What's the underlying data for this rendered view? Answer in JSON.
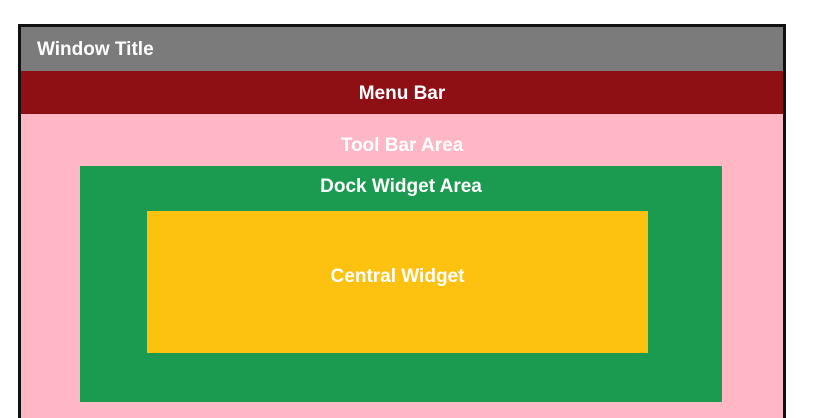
{
  "window": {
    "title": "Window Title"
  },
  "menu_bar": {
    "label": "Menu Bar"
  },
  "tool_bar": {
    "label": "Tool Bar Area"
  },
  "dock_widget": {
    "label": "Dock Widget Area"
  },
  "central_widget": {
    "label": "Central Widget"
  },
  "colors": {
    "title_bar": "#7b7b7b",
    "menu_bar": "#8e1015",
    "tool_bar_area": "#ffb6c5",
    "dock_widget_area": "#1a9b4f",
    "central_widget": "#fdc20f",
    "text": "#ffffff",
    "border": "#111111"
  }
}
